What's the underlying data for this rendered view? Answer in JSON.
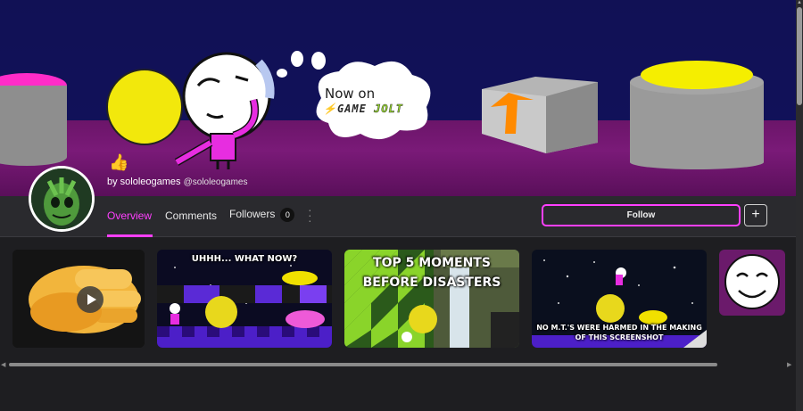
{
  "banner": {
    "now_on": "Now on",
    "logo_game": "GAME",
    "logo_jolt": "JOLT"
  },
  "profile": {
    "reaction_emoji": "👍",
    "by_label": "by sololeogames",
    "handle": "@sololeogames"
  },
  "nav": {
    "tabs": [
      {
        "label": "Overview",
        "active": true
      },
      {
        "label": "Comments",
        "active": false
      },
      {
        "label": "Followers",
        "active": false,
        "count": "0"
      }
    ],
    "more_icon": "kebab-vertical-icon",
    "follow_label": "Follow",
    "add_label": "+"
  },
  "posts": [
    {
      "type": "video",
      "title": ""
    },
    {
      "type": "image",
      "title": "UHHH... WHAT NOW?"
    },
    {
      "type": "image",
      "title": "TOP 5 MOMENTS\nBEFORE DISASTERS"
    },
    {
      "type": "image",
      "title": "NO M.T.'S WERE HARMED IN THE MAKING OF THIS SCREENSHOT"
    },
    {
      "type": "image",
      "title": ""
    }
  ],
  "colors": {
    "accent": "#ff3fff",
    "page_bg": "#1e1e21",
    "nav_bg": "#2a2a2e",
    "jolt_green": "#9adf2b"
  }
}
